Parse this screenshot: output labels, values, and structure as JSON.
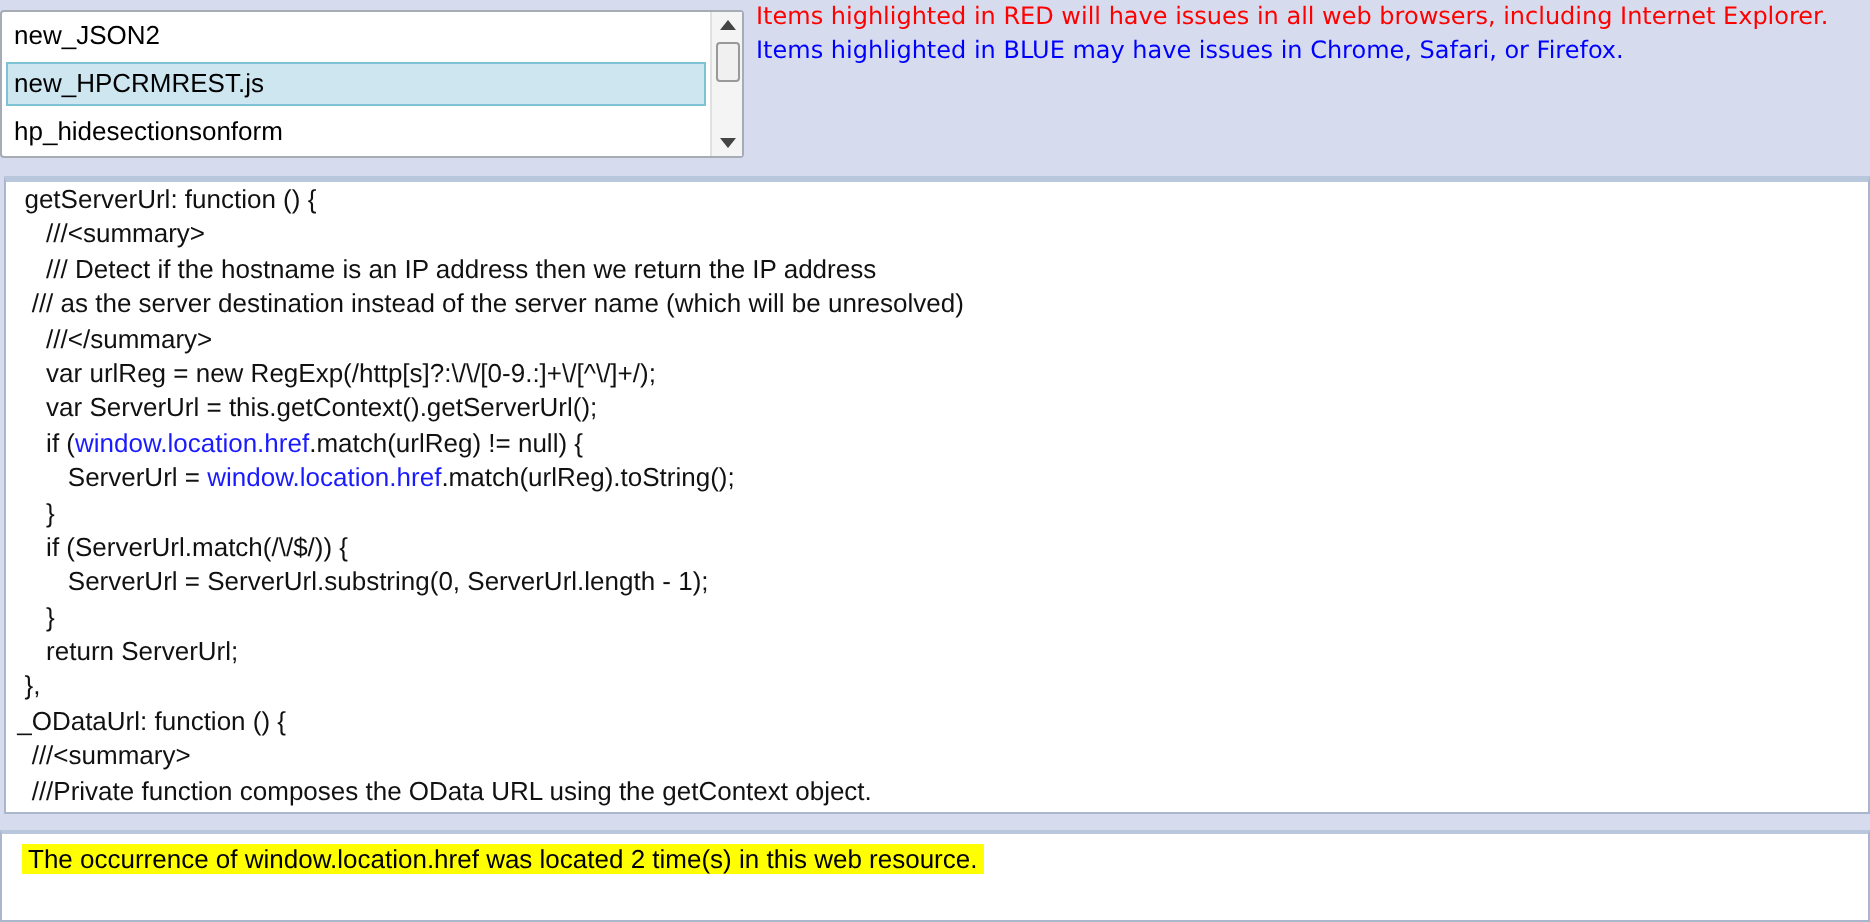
{
  "resource_list": {
    "items": [
      {
        "label": "new_JSON2",
        "selected": false
      },
      {
        "label": "new_HPCRMREST.js",
        "selected": true
      },
      {
        "label": "hp_hidesectionsonform",
        "selected": false
      }
    ]
  },
  "legend": [
    {
      "text": "Items highlighted in RED will have issues in all web browsers, including Internet Explorer.",
      "color": "#ff0000"
    },
    {
      "text": "Items highlighted in BLUE may have issues in Chrome, Safari, or Firefox.",
      "color": "#0000ff"
    }
  ],
  "code": {
    "lines": [
      [
        {
          "text": "  getServerUrl: function () {",
          "highlighted": false
        }
      ],
      [
        {
          "text": "     ///<summary>",
          "highlighted": false
        }
      ],
      [
        {
          "text": "     /// Detect if the hostname is an IP address then we return the IP address",
          "highlighted": false
        }
      ],
      [
        {
          "text": "   /// as the server destination instead of the server name (which will be unresolved)",
          "highlighted": false
        }
      ],
      [
        {
          "text": "     ///</summary>",
          "highlighted": false
        }
      ],
      [
        {
          "text": "     var urlReg = new RegExp(/http[s]?:\\/\\/[0-9.:]+\\/[^\\/]+/);",
          "highlighted": false
        }
      ],
      [
        {
          "text": "     var ServerUrl = this.getContext().getServerUrl();",
          "highlighted": false
        }
      ],
      [
        {
          "text": "     if (",
          "highlighted": false
        },
        {
          "text": "window.location.href",
          "highlighted": true
        },
        {
          "text": ".match(urlReg) != null) {",
          "highlighted": false
        }
      ],
      [
        {
          "text": "        ServerUrl = ",
          "highlighted": false
        },
        {
          "text": "window.location.href",
          "highlighted": true
        },
        {
          "text": ".match(urlReg).toString();",
          "highlighted": false
        }
      ],
      [
        {
          "text": "     }",
          "highlighted": false
        }
      ],
      [
        {
          "text": "     if (ServerUrl.match(/\\/$/)) {",
          "highlighted": false
        }
      ],
      [
        {
          "text": "        ServerUrl = ServerUrl.substring(0, ServerUrl.length - 1);",
          "highlighted": false
        }
      ],
      [
        {
          "text": "     }",
          "highlighted": false
        }
      ],
      [
        {
          "text": "     return ServerUrl;",
          "highlighted": false
        }
      ],
      [
        {
          "text": "  },",
          "highlighted": false
        }
      ],
      [
        {
          "text": " _ODataUrl: function () {",
          "highlighted": false
        }
      ],
      [
        {
          "text": "   ///<summary>",
          "highlighted": false
        }
      ],
      [
        {
          "text": "   ///Private function composes the OData URL using the getContext object.",
          "highlighted": false
        }
      ]
    ]
  },
  "result": {
    "text": "The occurrence of window.location.href was located 2 time(s) in this web resource."
  }
}
